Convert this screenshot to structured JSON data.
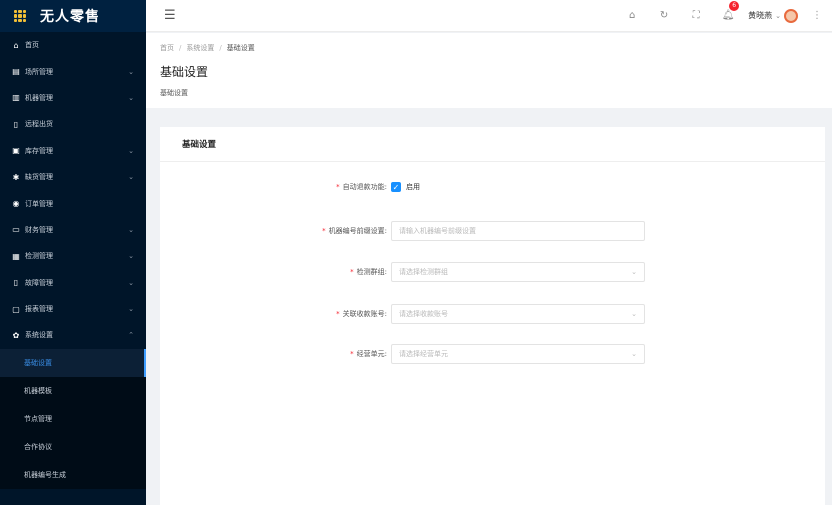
{
  "app": {
    "title": "无人零售"
  },
  "sidebar": {
    "items": [
      {
        "label": "首页",
        "icon": "home-icon",
        "glyph": "⌂",
        "arrow": ""
      },
      {
        "label": "场所管理",
        "icon": "store-icon",
        "glyph": "▤",
        "arrow": "⌄"
      },
      {
        "label": "机器管理",
        "icon": "machine-icon",
        "glyph": "▥",
        "arrow": "⌄"
      },
      {
        "label": "远程出货",
        "icon": "remote-icon",
        "glyph": "▯",
        "arrow": ""
      },
      {
        "label": "库存管理",
        "icon": "inventory-icon",
        "glyph": "▣",
        "arrow": "⌄"
      },
      {
        "label": "缺货管理",
        "icon": "wrench-icon",
        "glyph": "✱",
        "arrow": "⌄"
      },
      {
        "label": "订单管理",
        "icon": "order-icon",
        "glyph": "◉",
        "arrow": ""
      },
      {
        "label": "财务管理",
        "icon": "finance-icon",
        "glyph": "▭",
        "arrow": "⌄"
      },
      {
        "label": "检测管理",
        "icon": "check-icon",
        "glyph": "▦",
        "arrow": "⌄"
      },
      {
        "label": "故障管理",
        "icon": "fault-icon",
        "glyph": "▯",
        "arrow": "⌄"
      },
      {
        "label": "报表管理",
        "icon": "report-icon",
        "glyph": "▢",
        "arrow": "⌄"
      },
      {
        "label": "系统设置",
        "icon": "gear-icon",
        "glyph": "✿",
        "arrow": "⌃"
      }
    ],
    "subitems": [
      {
        "label": "基础设置",
        "active": true
      },
      {
        "label": "机器模板",
        "active": false
      },
      {
        "label": "节点管理",
        "active": false
      },
      {
        "label": "合作协议",
        "active": false
      },
      {
        "label": "机器编号生成",
        "active": false
      }
    ]
  },
  "header": {
    "badge_count": "6",
    "username": "黄晓燕"
  },
  "breadcrumb": {
    "items": [
      "首页",
      "系统设置",
      "基础设置"
    ]
  },
  "page": {
    "title": "基础设置",
    "subtitle": "基础设置"
  },
  "card": {
    "title": "基础设置"
  },
  "form": {
    "auto_refund": {
      "label": "自动退款功能:",
      "checkbox_label": "启用",
      "checked": true
    },
    "prefix": {
      "label": "机器编号前缀设置:",
      "placeholder": "请输入机器编号前缀设置"
    },
    "group": {
      "label": "检测群组:",
      "placeholder": "请选择检测群组"
    },
    "account": {
      "label": "关联收款账号:",
      "placeholder": "请选择收款账号"
    },
    "unit": {
      "label": "经营单元:",
      "placeholder": "请选择经营单元"
    }
  },
  "colors": {
    "sidebar_bg": "#001529",
    "accent": "#1890ff",
    "required": "#f5222d"
  }
}
